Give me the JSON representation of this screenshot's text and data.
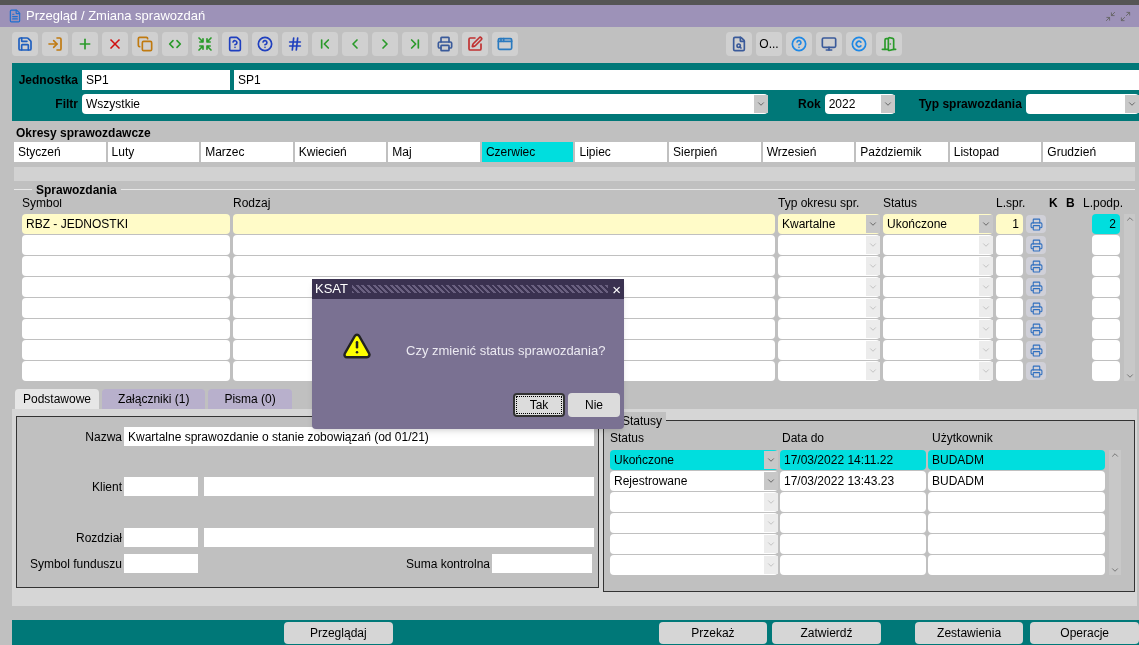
{
  "window": {
    "title": "Przegląd / Zmiana sprawozdań"
  },
  "toolbar": {
    "text_button": "O..."
  },
  "header": {
    "unit_label": "Jednostka",
    "unit_code": "SP1",
    "unit_name": "SP1",
    "filter_label": "Filtr",
    "filter_value": "Wszystkie",
    "year_label": "Rok",
    "year_value": "2022",
    "type_label": "Typ sprawozdania"
  },
  "periods": {
    "title": "Okresy sprawozdawcze",
    "months": [
      {
        "label": "Styczeń",
        "selected": false
      },
      {
        "label": "Luty",
        "selected": false
      },
      {
        "label": "Marzec",
        "selected": false
      },
      {
        "label": "Kwiecień",
        "selected": false
      },
      {
        "label": "Maj",
        "selected": false
      },
      {
        "label": "Czerwiec",
        "selected": true
      },
      {
        "label": "Lipiec",
        "selected": false
      },
      {
        "label": "Sierpień",
        "selected": false
      },
      {
        "label": "Wrzesień",
        "selected": false
      },
      {
        "label": "Pażdziemik",
        "selected": false
      },
      {
        "label": "Listopad",
        "selected": false
      },
      {
        "label": "Grudzień",
        "selected": false
      }
    ]
  },
  "reports": {
    "title": "Sprawozdania",
    "columns": [
      "Symbol",
      "Rodzaj",
      "Typ okresu spr.",
      "Status",
      "L.spr.",
      "K",
      "B",
      "L.podp."
    ],
    "rows": [
      {
        "symbol": "RBZ - JEDNOSTKI",
        "period_type": "Kwartalne",
        "status": "Ukończone",
        "l_spr": "1",
        "l_podp": "2",
        "selected": true,
        "l_podp_focused": true
      }
    ]
  },
  "tabs": [
    {
      "label": "Podstawowe",
      "selected": true
    },
    {
      "label": "Załączniki (1)",
      "selected": false
    },
    {
      "label": "Pisma (0)",
      "selected": false
    }
  ],
  "details": {
    "name_label": "Nazwa",
    "name_value": "Kwartalne sprawozdanie o stanie zobowiązań (od 01/21)",
    "client_label": "Klient",
    "section_label": "Rozdział",
    "fund_label": "Symbol funduszu",
    "checksum_label": "Suma kontrolna"
  },
  "statuses": {
    "title": "Statusy",
    "columns": [
      "Status",
      "Data do",
      "Użytkownik"
    ],
    "rows": [
      {
        "status": "Ukończone",
        "date": "17/03/2022 14:11.22",
        "user": "BUDADM",
        "selected": true
      },
      {
        "status": "Rejestrowane",
        "date": "17/03/2022 13:43.23",
        "user": "BUDADM",
        "selected": false
      }
    ]
  },
  "buttons": [
    "Przeglądaj",
    "Przekaż",
    "Zatwierdź",
    "Zestawienia",
    "Operacje"
  ],
  "dialog": {
    "title": "KSAT",
    "close": "×",
    "message": "Czy zmienić status sprawozdania?",
    "buttons": [
      {
        "label": "Tak",
        "default": true
      },
      {
        "label": "Nie",
        "default": false
      }
    ]
  }
}
